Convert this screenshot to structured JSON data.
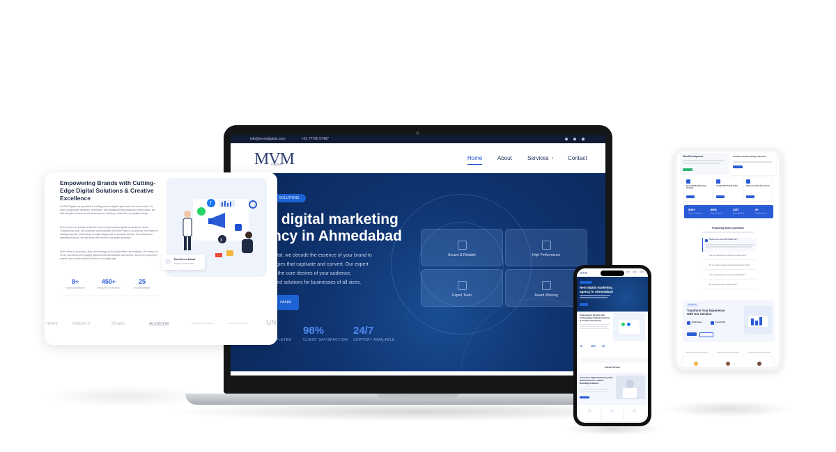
{
  "laptop": {
    "topbar": {
      "email": "info@mvmdigitals.com",
      "phone": "+91 77790 97457"
    },
    "logo": "MVM",
    "logo_sub": "Digitals",
    "nav": [
      "Home",
      "About",
      "Services",
      "Contact"
    ],
    "badge": "SOLUTIONS",
    "headline_1": "t digital marketing",
    "headline_2": "ncy in Ahmedabad",
    "body_lines": [
      "igital, we decode the essence of your brand to",
      "tegies that captivate and convert. Our expert",
      "to the core desires of your audience,",
      "ored solutions for businesses of all sizes."
    ],
    "cta": "rvices",
    "cards": [
      "Secure & Reliable",
      "High Performance",
      "Expert Team",
      "Award Winning"
    ],
    "stats": [
      {
        "value": "98%",
        "label": "CLIENT SATISFACTION"
      },
      {
        "value": "24/7",
        "label": "SUPPORT AVAILABLE"
      }
    ],
    "stat_partial_label": "PLETED"
  },
  "left_card": {
    "title": "Empowering Brands with Cutting-Edge Digital Solutions & Creative Excellence",
    "paragraphs": [
      "At MVM Digitals, we specialise in crafting powerful digital experiences that drive results. Our team of passionate designers, developers, and strategists bring creativity to every project. We offer bespoke solutions in web development, branding, multimedia, and graphic design.",
      "Every service we provide is tailored to your unique business goals and audience needs. Transparency, trust, and consistent communication are at the heart of our process. We believe in building long-term partnerships through integrity and measurable success. From startups to established brands, we help every client thrive in the digital landscape.",
      "With a blend of innovation, style, and strategy, we don't just deliver, we transform. Our mission is to turn your ideas into engaging digital stories that captivate and convert. Join us on a journey to redefine your brand's future and thrive in the digital age."
    ],
    "stats": [
      {
        "value": "8+",
        "label": "YEARS EXPERIENCE"
      },
      {
        "value": "450+",
        "label": "PROJECTS COMPLETED"
      },
      {
        "value": "25",
        "label": "TEAM MEMBERS"
      }
    ],
    "award": {
      "title": "Excellence Award",
      "subtitle": "Digital Innovation 2023"
    },
    "logos": [
      "TRADE",
      "DEALER N",
      "Sharini",
      "ecotone",
      "THE BEST GARMENTS",
      "PHOTINGO STUDIO",
      "UN"
    ]
  },
  "phone": {
    "hero_title": "Best digital marketing agency in Ahmedabad",
    "section_title": "Empowering Brands with Cutting-Edge Digital Solutions & Creative Excellence",
    "stats": [
      "8+",
      "450+",
      "25"
    ],
    "featured": "Featured Services",
    "section2_title": "Innovative Digital Marketing, Web Development & Creative Branding Solutions"
  },
  "tablet": {
    "services": [
      "Web Development",
      "Creative Graphic Design Services",
      "Social Media Marketing Strategy",
      "Google SEO Setup Token",
      "Brand & Online Promotions"
    ],
    "stats": [
      {
        "value": "500+",
        "label": "Projects Completed"
      },
      {
        "value": "98%",
        "label": "Client Satisfaction"
      },
      {
        "value": "24/7",
        "label": "Support Available"
      },
      {
        "value": "5+",
        "label": "Years Experience"
      }
    ],
    "faq_title": "Frequently Asked Questions",
    "faq_items": [
      "What services does MVM Digitals offer?",
      "How long does it take to complete a website project?",
      "Do you provide ongoing support after the website launch?",
      "Can you help improve my existing website's SEO?",
      "Do you provide custom website design?"
    ],
    "cta_badge": "Contact Us",
    "cta_title": "Transform Your Experience With Our Solution",
    "cta_items": [
      "Quick Setup",
      "Expert Help"
    ]
  }
}
